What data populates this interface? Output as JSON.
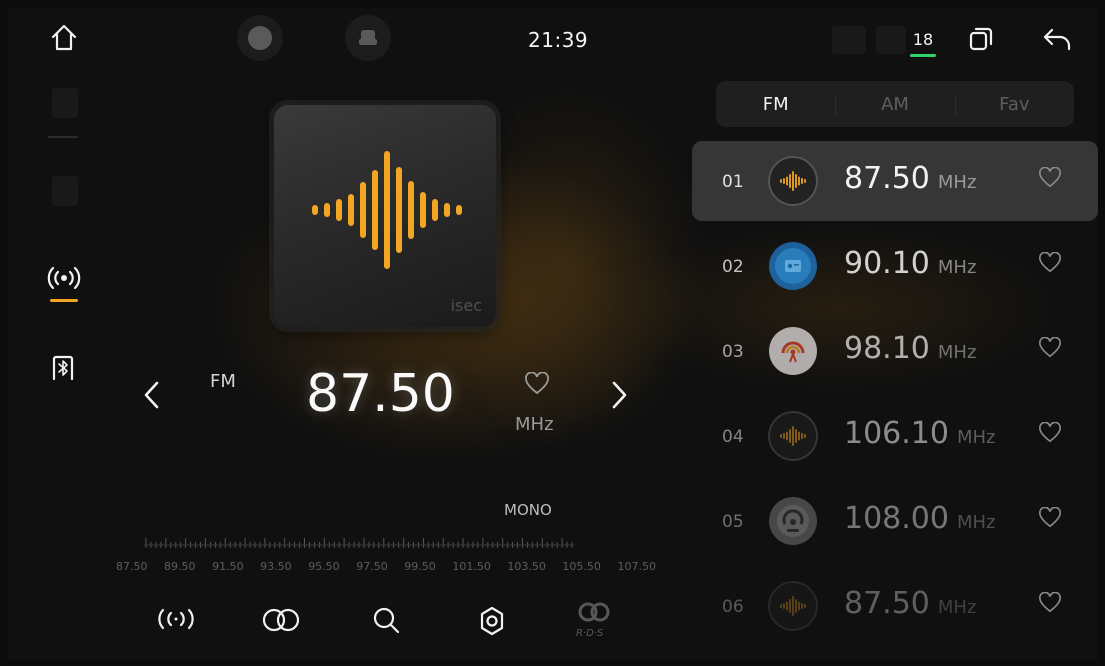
{
  "status_bar": {
    "time": "21:39",
    "temperature": "18",
    "icons": [
      "home-icon",
      "record-icon",
      "car-icon",
      "bluetooth-icon",
      "window-icon",
      "back-icon"
    ]
  },
  "side_nav": {
    "items": [
      {
        "name": "radio",
        "icon": "radio-icon",
        "active": true
      },
      {
        "name": "bluetooth-music",
        "icon": "bluetooth-music-icon",
        "active": false
      }
    ]
  },
  "player": {
    "band": "FM",
    "frequency": "87.50",
    "unit": "MHz",
    "mono": "MONO",
    "art_brand": "isec",
    "scale": [
      "87.50",
      "89.50",
      "91.50",
      "93.50",
      "95.50",
      "97.50",
      "99.50",
      "101.50",
      "103.50",
      "105.50",
      "107.50"
    ]
  },
  "controls": [
    "scan-icon",
    "stereo-icon",
    "search-icon",
    "settings-icon",
    "rds-icon"
  ],
  "tabs": [
    {
      "label": "FM",
      "active": true
    },
    {
      "label": "AM",
      "active": false
    },
    {
      "label": "Fav",
      "active": false
    }
  ],
  "stations": [
    {
      "num": "01",
      "freq": "87.50",
      "unit": "MHz",
      "logo": "waveform",
      "active": true
    },
    {
      "num": "02",
      "freq": "90.10",
      "unit": "MHz",
      "logo": "blue-radio",
      "active": false
    },
    {
      "num": "03",
      "freq": "98.10",
      "unit": "MHz",
      "logo": "red-broadcast",
      "active": false
    },
    {
      "num": "04",
      "freq": "106.10",
      "unit": "MHz",
      "logo": "waveform",
      "active": false
    },
    {
      "num": "05",
      "freq": "108.00",
      "unit": "MHz",
      "logo": "grey-broadcast",
      "active": false
    },
    {
      "num": "06",
      "freq": "87.50",
      "unit": "MHz",
      "logo": "waveform",
      "active": false
    }
  ],
  "colors": {
    "accent": "#f2a623",
    "indicator_green": "#2fd26b",
    "active_row": "#555555"
  }
}
